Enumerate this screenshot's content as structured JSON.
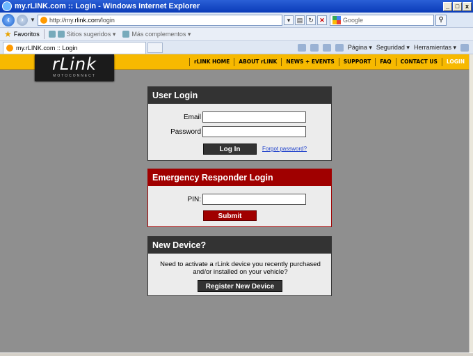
{
  "window": {
    "title": "my.rLINK.com :: Login - Windows Internet Explorer",
    "controls": [
      "_",
      "□",
      "x"
    ]
  },
  "address_bar": {
    "url_prefix": "http://my.",
    "url_host": "rlink.com",
    "url_path": "/login",
    "search_placeholder": "Google"
  },
  "favorites_bar": {
    "favorites": "Favoritos",
    "suggested": "Sitios sugeridos ▾",
    "addons": "Más complementos ▾"
  },
  "tab_bar": {
    "tab_title": "my.rLINK.com :: Login",
    "commands": [
      "Página ▾",
      "Seguridad ▾",
      "Herramientas ▾"
    ]
  },
  "site": {
    "logo_text": "rLink",
    "logo_tagline": "MOTOCONNECT",
    "nav": [
      "rLINK HOME",
      "ABOUT rLINK",
      "NEWS + EVENTS",
      "SUPPORT",
      "FAQ",
      "CONTACT US",
      "LOGIN"
    ]
  },
  "user_login": {
    "title": "User Login",
    "email_label": "Email",
    "email_value": "",
    "password_label": "Password",
    "password_value": "",
    "login_button": "Log In",
    "forgot_link": "Forgot password?"
  },
  "emergency_login": {
    "title": "Emergency Responder Login",
    "pin_label": "PIN:",
    "pin_value": "",
    "submit_button": "Submit"
  },
  "new_device": {
    "title": "New Device?",
    "message_line1": "Need to activate a rLink device you recently purchased",
    "message_line2": "and/or installed on your vehicle?",
    "register_button": "Register New Device"
  },
  "colors": {
    "nav_bar": "#f7b900",
    "panel_dark": "#333333",
    "panel_red": "#a00000",
    "page_bg": "#8f8f8f"
  }
}
